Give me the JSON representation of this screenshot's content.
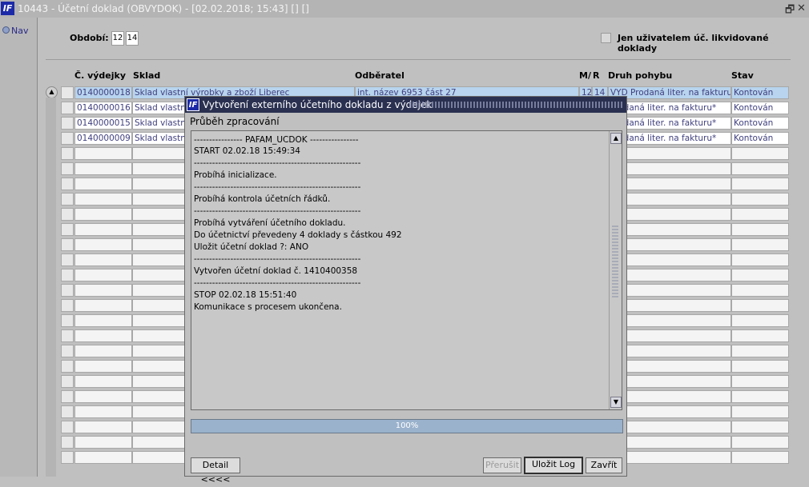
{
  "window": {
    "title": "10443 - Účetní doklad (OBVYDOK) - [02.02.2018; 15:43] [] []",
    "logo": "IF",
    "restore_icon": "🗗",
    "close_icon": "✕"
  },
  "nav": {
    "label": "Nav"
  },
  "filters": {
    "obdobi_label": "Období:",
    "obdobi_from": "12",
    "obdobi_to": "14",
    "only_user_label": "Jen uživatelem úč. likvidované doklady"
  },
  "table": {
    "columns": [
      "Č. výdejky",
      "Sklad",
      "Odběratel",
      "M/",
      "R",
      "Druh pohybu",
      "Stav"
    ],
    "rows": [
      {
        "cislo": "0140000018",
        "sklad": "Sklad vlastní výrobky a zboží Liberec",
        "odberatel": "int. název 6953 část 27",
        "m": "12",
        "r": "14",
        "druh": "VYD Prodaná liter. na fakturu*",
        "stav": "Kontován"
      },
      {
        "cislo": "0140000016",
        "sklad": "Sklad vlastní",
        "odberatel": "",
        "m": "",
        "r": "",
        "druh": "Prodaná liter. na fakturu*",
        "stav": "Kontován"
      },
      {
        "cislo": "0140000015",
        "sklad": "Sklad vlastní",
        "odberatel": "",
        "m": "",
        "r": "",
        "druh": "Prodaná liter. na fakturu*",
        "stav": "Kontován"
      },
      {
        "cislo": "0140000009",
        "sklad": "Sklad vlastní",
        "odberatel": "",
        "m": "",
        "r": "",
        "druh": "Prodaná liter. na fakturu*",
        "stav": "Kontován"
      }
    ]
  },
  "dialog": {
    "title": "Vytvoření externího účetního dokladu z výdejek",
    "subtitle": "Průběh zpracování",
    "log_lines": [
      "---------------- PAFAM_UCDOK ----------------",
      "START 02.02.18 15:49:34",
      "-------------------------------------------------------",
      "Probíhá inicializace.",
      "-------------------------------------------------------",
      "Probíhá kontrola účetních řádků.",
      "-------------------------------------------------------",
      "Probíhá vytváření účetního dokladu.",
      "Do účetnictví  převedeny 4 doklady s částkou 492",
      " Uložit účetní doklad ?: ANO",
      "-------------------------------------------------------",
      "Vytvořen účetní doklad č. 1410400358",
      "-------------------------------------------------------",
      "STOP 02.02.18 15:51:40",
      "Komunikace s procesem ukončena."
    ],
    "progress": 100,
    "progress_label": "100%",
    "detail_button": "Detail <<<<",
    "prerusit_button": "Přerušit",
    "ulozit_button": "Uložit Log",
    "zavrit_button": "Zavřít"
  }
}
